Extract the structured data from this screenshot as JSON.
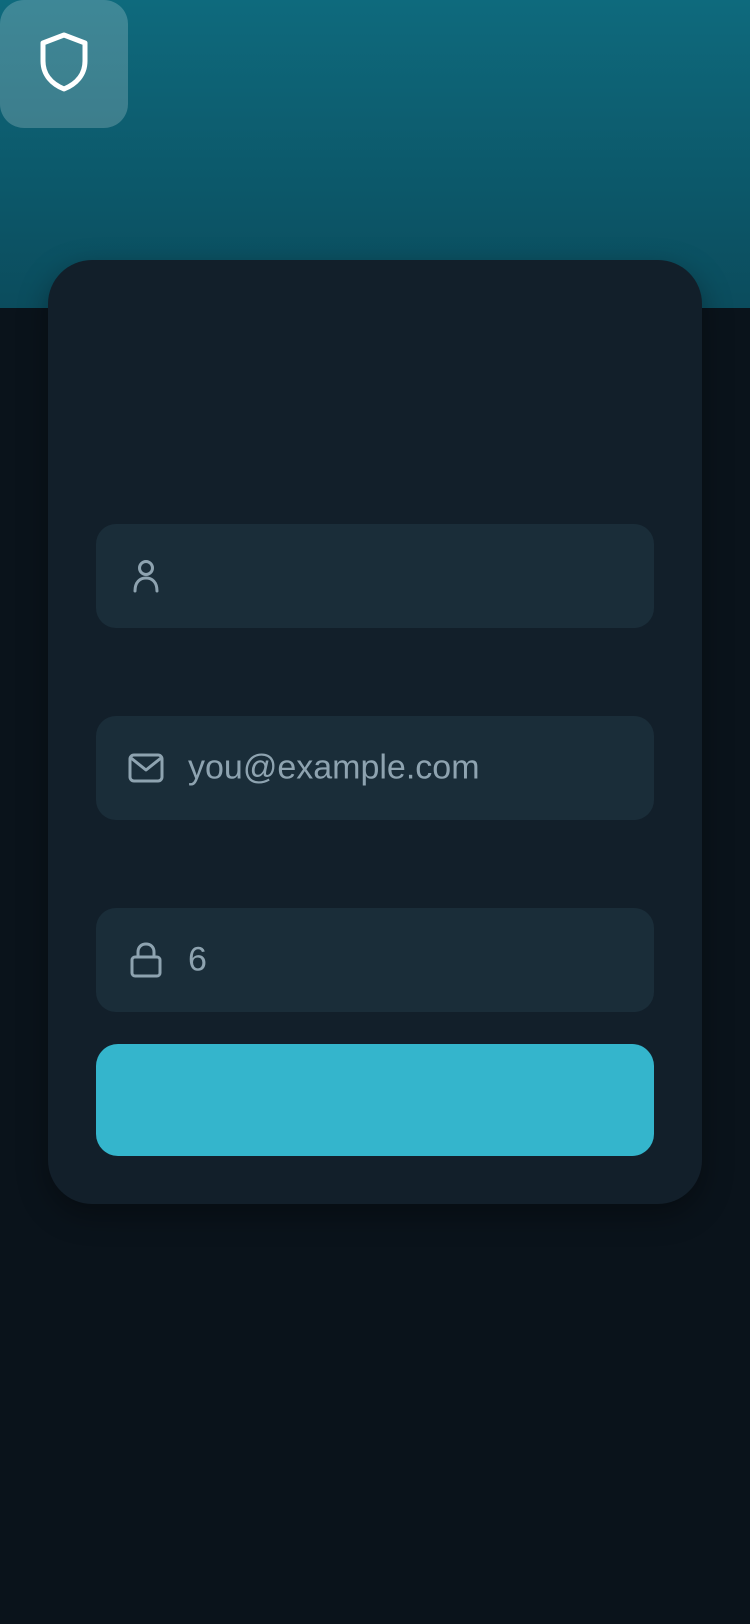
{
  "header": {
    "logo_icon": "shield-icon"
  },
  "form": {
    "name_field": {
      "icon": "user-icon",
      "value": ""
    },
    "email_field": {
      "icon": "mail-icon",
      "placeholder": "you@example.com"
    },
    "password_field": {
      "icon": "lock-icon",
      "value": "6"
    },
    "submit_button": {
      "label": ""
    }
  },
  "colors": {
    "accent": "#34b5cc",
    "hero_top": "#0e6a7d",
    "card_background": "#121f2a",
    "field_background": "#1a2d39",
    "page_background": "#0a131b",
    "placeholder_text": "#8ea3b0"
  }
}
